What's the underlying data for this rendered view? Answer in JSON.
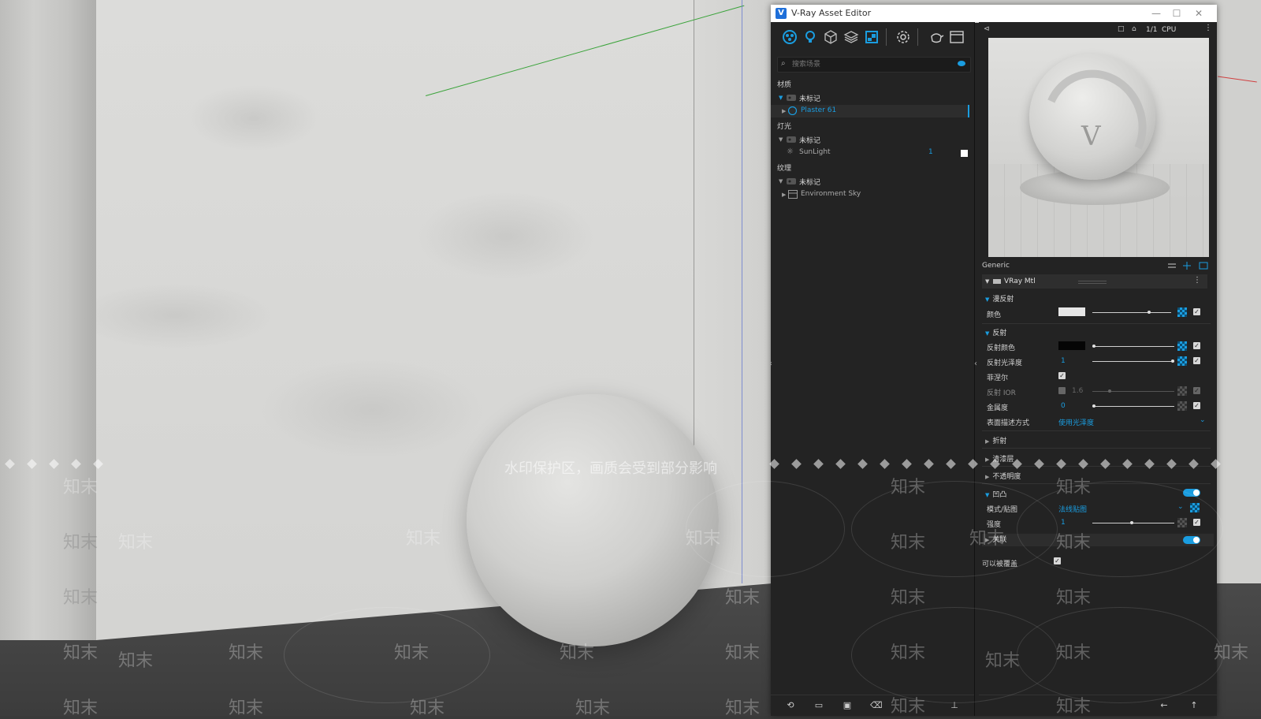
{
  "window": {
    "logo": "V",
    "title": "V-Ray Asset Editor",
    "controls": [
      "—",
      "☐",
      "✕"
    ]
  },
  "toolbar": {
    "icons": [
      "materials-icon",
      "lights-icon",
      "geometry-icon",
      "layers-icon",
      "textures-icon",
      "settings-icon",
      "render-teapot-icon",
      "frame-buffer-icon"
    ]
  },
  "search": {
    "placeholder": "搜索场景"
  },
  "tree": {
    "materials": {
      "label": "材质",
      "group_label": "未标记",
      "items": [
        {
          "label": "Plaster 61"
        }
      ]
    },
    "lights": {
      "label": "灯光",
      "group_label": "未标记",
      "items": [
        {
          "label": "SunLight",
          "count": "1"
        }
      ]
    },
    "textures": {
      "label": "纹理",
      "group_label": "未标记",
      "items": [
        {
          "label": "Environment Sky"
        }
      ]
    }
  },
  "preview": {
    "ratio": "1/1",
    "engine": "CPU",
    "logo_text": "V"
  },
  "properties": {
    "generic_label": "Generic",
    "material_type": "VRay Mtl",
    "diffuse": {
      "section": "漫反射",
      "color_label": "颜色",
      "color": "#e6e6e6"
    },
    "reflection": {
      "section": "反射",
      "reflection_color_label": "反射颜色",
      "reflection_color": "#050505",
      "glossiness_label": "反射光泽度",
      "glossiness_value": "1",
      "fresnel_label": "菲涅尔",
      "ior_label": "反射 IOR",
      "ior_value": "1.6",
      "metalness_label": "金属度",
      "metalness_value": "0",
      "brdf_label": "表面描述方式",
      "brdf_value": "使用光泽度"
    },
    "refraction_section": "折射",
    "coat_section": "清漆层",
    "opacity_section": "不透明度",
    "bump": {
      "section": "凹凸",
      "mode_label": "模式/贴图",
      "mode_value": "法线贴图",
      "amount_label": "强度",
      "amount_value": "1"
    },
    "binding_section": "关联",
    "can_be_overridden_label": "可以被覆盖"
  },
  "watermark": {
    "banner": "水印保护区，画质会受到部分影响",
    "mark": "知末"
  },
  "colors": {
    "accent": "#1a9de0",
    "panel_bg": "#232323"
  }
}
